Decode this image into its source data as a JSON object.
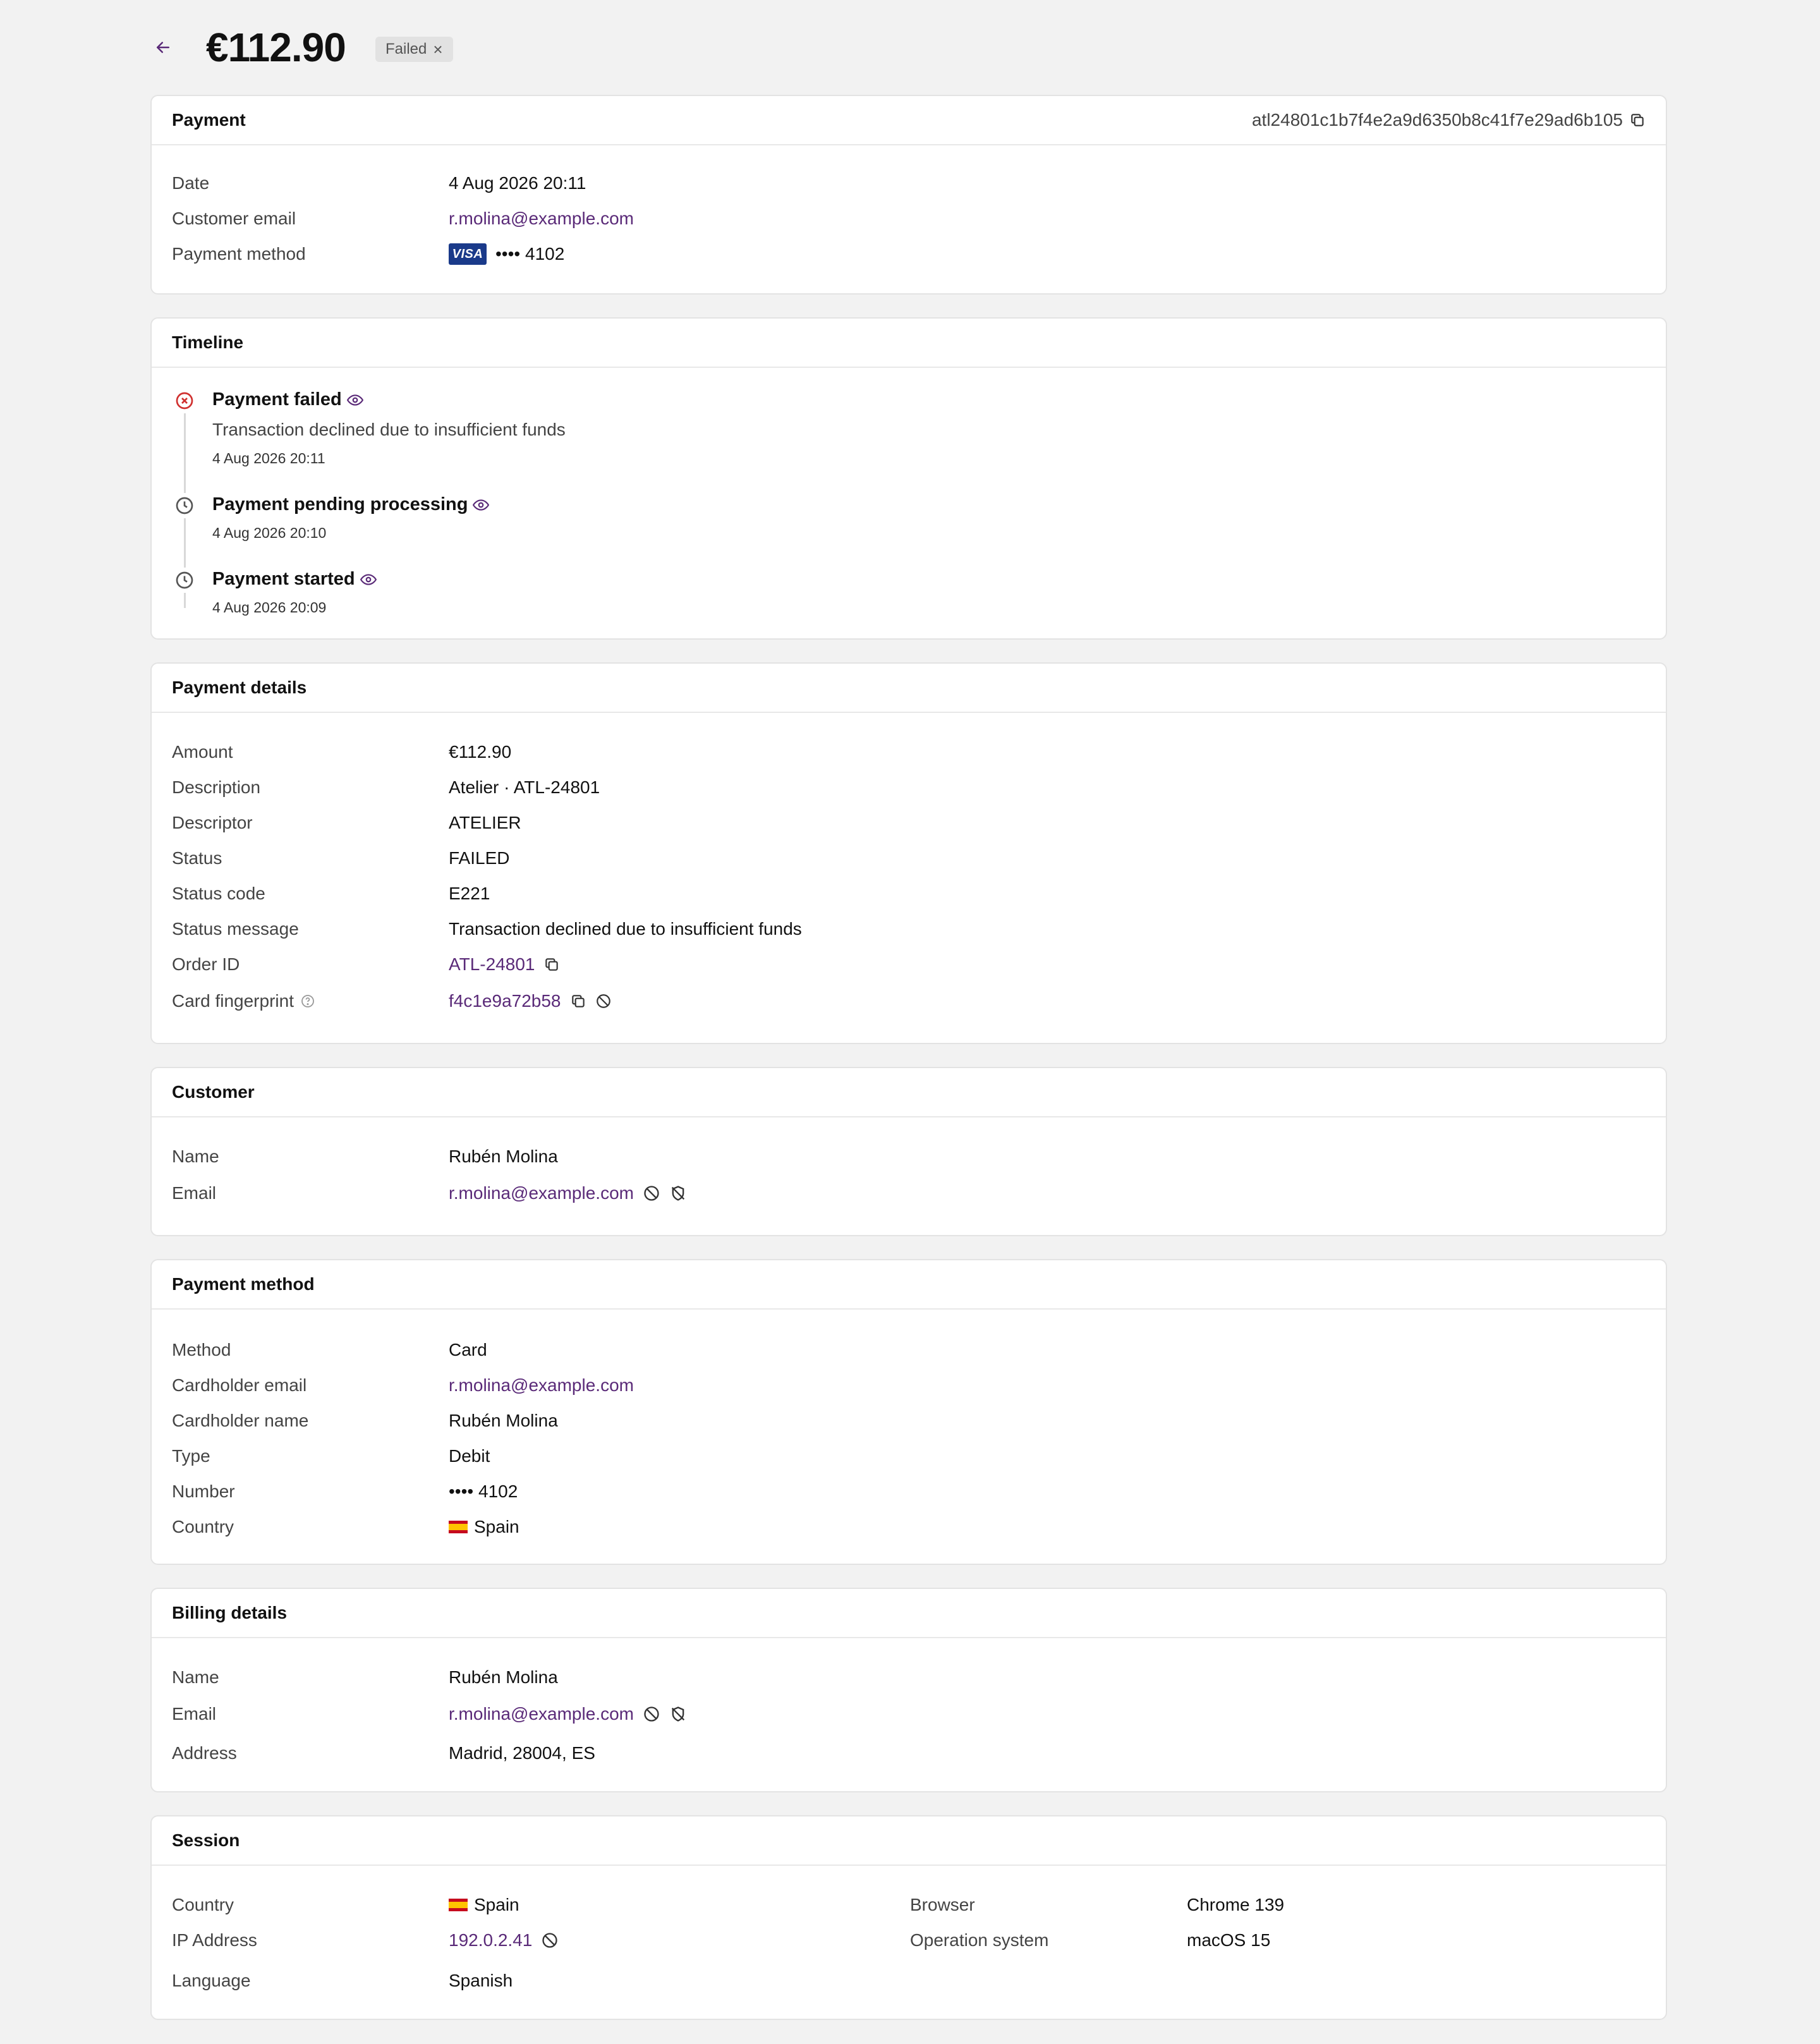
{
  "header": {
    "amount": "€112.90",
    "status_badge": "Failed"
  },
  "payment_card": {
    "title": "Payment",
    "payment_id": "atl24801c1b7f4e2a9d6350b8c41f7e29ad6b105",
    "rows": {
      "date_label": "Date",
      "date_value": "4 Aug 2026 20:11",
      "email_label": "Customer email",
      "email_value": "r.molina@example.com",
      "method_label": "Payment method",
      "card_brand": "VISA",
      "card_number": "•••• 4102"
    }
  },
  "timeline": {
    "title": "Timeline",
    "events": [
      {
        "title": "Payment failed",
        "description": "Transaction declined due to insufficient funds",
        "time": "4 Aug 2026 20:11",
        "icon": "x-circle-icon"
      },
      {
        "title": "Payment pending processing",
        "time": "4 Aug 2026 20:10",
        "icon": "clock-icon"
      },
      {
        "title": "Payment started",
        "time": "4 Aug 2026 20:09",
        "icon": "clock-icon"
      }
    ]
  },
  "payment_details": {
    "title": "Payment details",
    "amount_label": "Amount",
    "amount_value": "€112.90",
    "description_label": "Description",
    "description_value": "Atelier · ATL-24801",
    "descriptor_label": "Descriptor",
    "descriptor_value": "ATELIER",
    "status_label": "Status",
    "status_value": "FAILED",
    "status_code_label": "Status code",
    "status_code_value": "E221",
    "status_message_label": "Status message",
    "status_message_value": "Transaction declined due to insufficient funds",
    "order_id_label": "Order ID",
    "order_id_value": "ATL-24801",
    "fingerprint_label": "Card fingerprint",
    "fingerprint_value": "f4c1e9a72b58"
  },
  "customer": {
    "title": "Customer",
    "name_label": "Name",
    "name_value": "Rubén Molina",
    "email_label": "Email",
    "email_value": "r.molina@example.com"
  },
  "payment_method": {
    "title": "Payment method",
    "method_label": "Method",
    "method_value": "Card",
    "cardholder_email_label": "Cardholder email",
    "cardholder_email_value": "r.molina@example.com",
    "cardholder_name_label": "Cardholder name",
    "cardholder_name_value": "Rubén Molina",
    "type_label": "Type",
    "type_value": "Debit",
    "number_label": "Number",
    "number_value": "•••• 4102",
    "country_label": "Country",
    "country_value": "Spain"
  },
  "billing": {
    "title": "Billing details",
    "name_label": "Name",
    "name_value": "Rubén Molina",
    "email_label": "Email",
    "email_value": "r.molina@example.com",
    "address_label": "Address",
    "address_value": "Madrid, 28004, ES"
  },
  "session": {
    "title": "Session",
    "country_label": "Country",
    "country_value": "Spain",
    "ip_label": "IP Address",
    "ip_value": "192.0.2.41",
    "language_label": "Language",
    "language_value": "Spanish",
    "browser_label": "Browser",
    "browser_value": "Chrome 139",
    "os_label": "Operation system",
    "os_value": "macOS 15"
  },
  "colors": {
    "link": "#5a2a78",
    "error": "#d0302f",
    "background": "#f2f2f2"
  }
}
